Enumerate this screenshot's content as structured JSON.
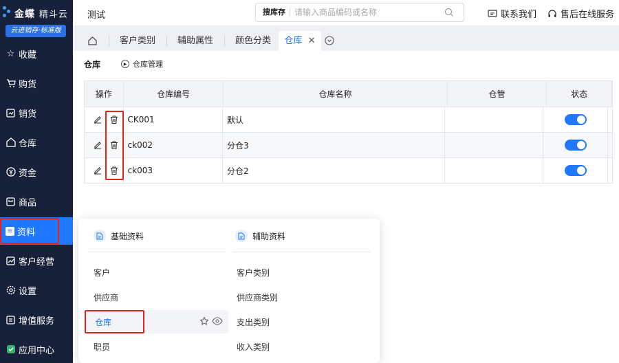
{
  "brand": {
    "name": "金蝶",
    "product": "精斗云",
    "edition": "云进销存·标准版"
  },
  "sidebar": {
    "items": [
      {
        "label": "收藏",
        "icon": "star-icon"
      },
      {
        "label": "购货",
        "icon": "cart-icon"
      },
      {
        "label": "销货",
        "icon": "invoice-icon"
      },
      {
        "label": "仓库",
        "icon": "warehouse-icon"
      },
      {
        "label": "资金",
        "icon": "yen-icon"
      },
      {
        "label": "商品",
        "icon": "goods-icon"
      },
      {
        "label": "资料",
        "icon": "data-icon"
      },
      {
        "label": "客户经营",
        "icon": "chart-icon"
      },
      {
        "label": "设置",
        "icon": "gear-icon"
      },
      {
        "label": "增值服务",
        "icon": "service-icon"
      },
      {
        "label": "应用中心",
        "icon": "check-icon"
      }
    ],
    "active_index": 6
  },
  "header": {
    "company": "测试",
    "search_scope": "搜库存",
    "search_placeholder": "请输入商品编码或名称",
    "contact_label": "联系我们",
    "support_label": "售后在线服务"
  },
  "tabs": [
    {
      "label": "客户类别"
    },
    {
      "label": "辅助属性"
    },
    {
      "label": "颜色分类"
    },
    {
      "label": "仓库",
      "active": true,
      "closable": true
    }
  ],
  "page": {
    "title": "仓库",
    "sub_link": "仓库管理"
  },
  "table": {
    "headers": [
      "操作",
      "仓库编号",
      "仓库名称",
      "仓管",
      "状态"
    ],
    "rows": [
      {
        "code": "CK001",
        "name": "默认",
        "manager": "",
        "enabled": true
      },
      {
        "code": "ck002",
        "name": "分仓3",
        "manager": "",
        "enabled": true
      },
      {
        "code": "ck003",
        "name": "分仓2",
        "manager": "",
        "enabled": true
      }
    ]
  },
  "dropdown": {
    "col1_title": "基础资料",
    "col2_title": "辅助资料",
    "col1_items": [
      "客户",
      "供应商",
      "仓库",
      "职员"
    ],
    "col2_items": [
      "客户类别",
      "供应商类别",
      "支出类别",
      "收入类别"
    ],
    "highlighted_item": "仓库"
  },
  "colors": {
    "sidebar_bg": "#17223a",
    "accent": "#1f78ff",
    "annotation_red": "#e5231b"
  }
}
